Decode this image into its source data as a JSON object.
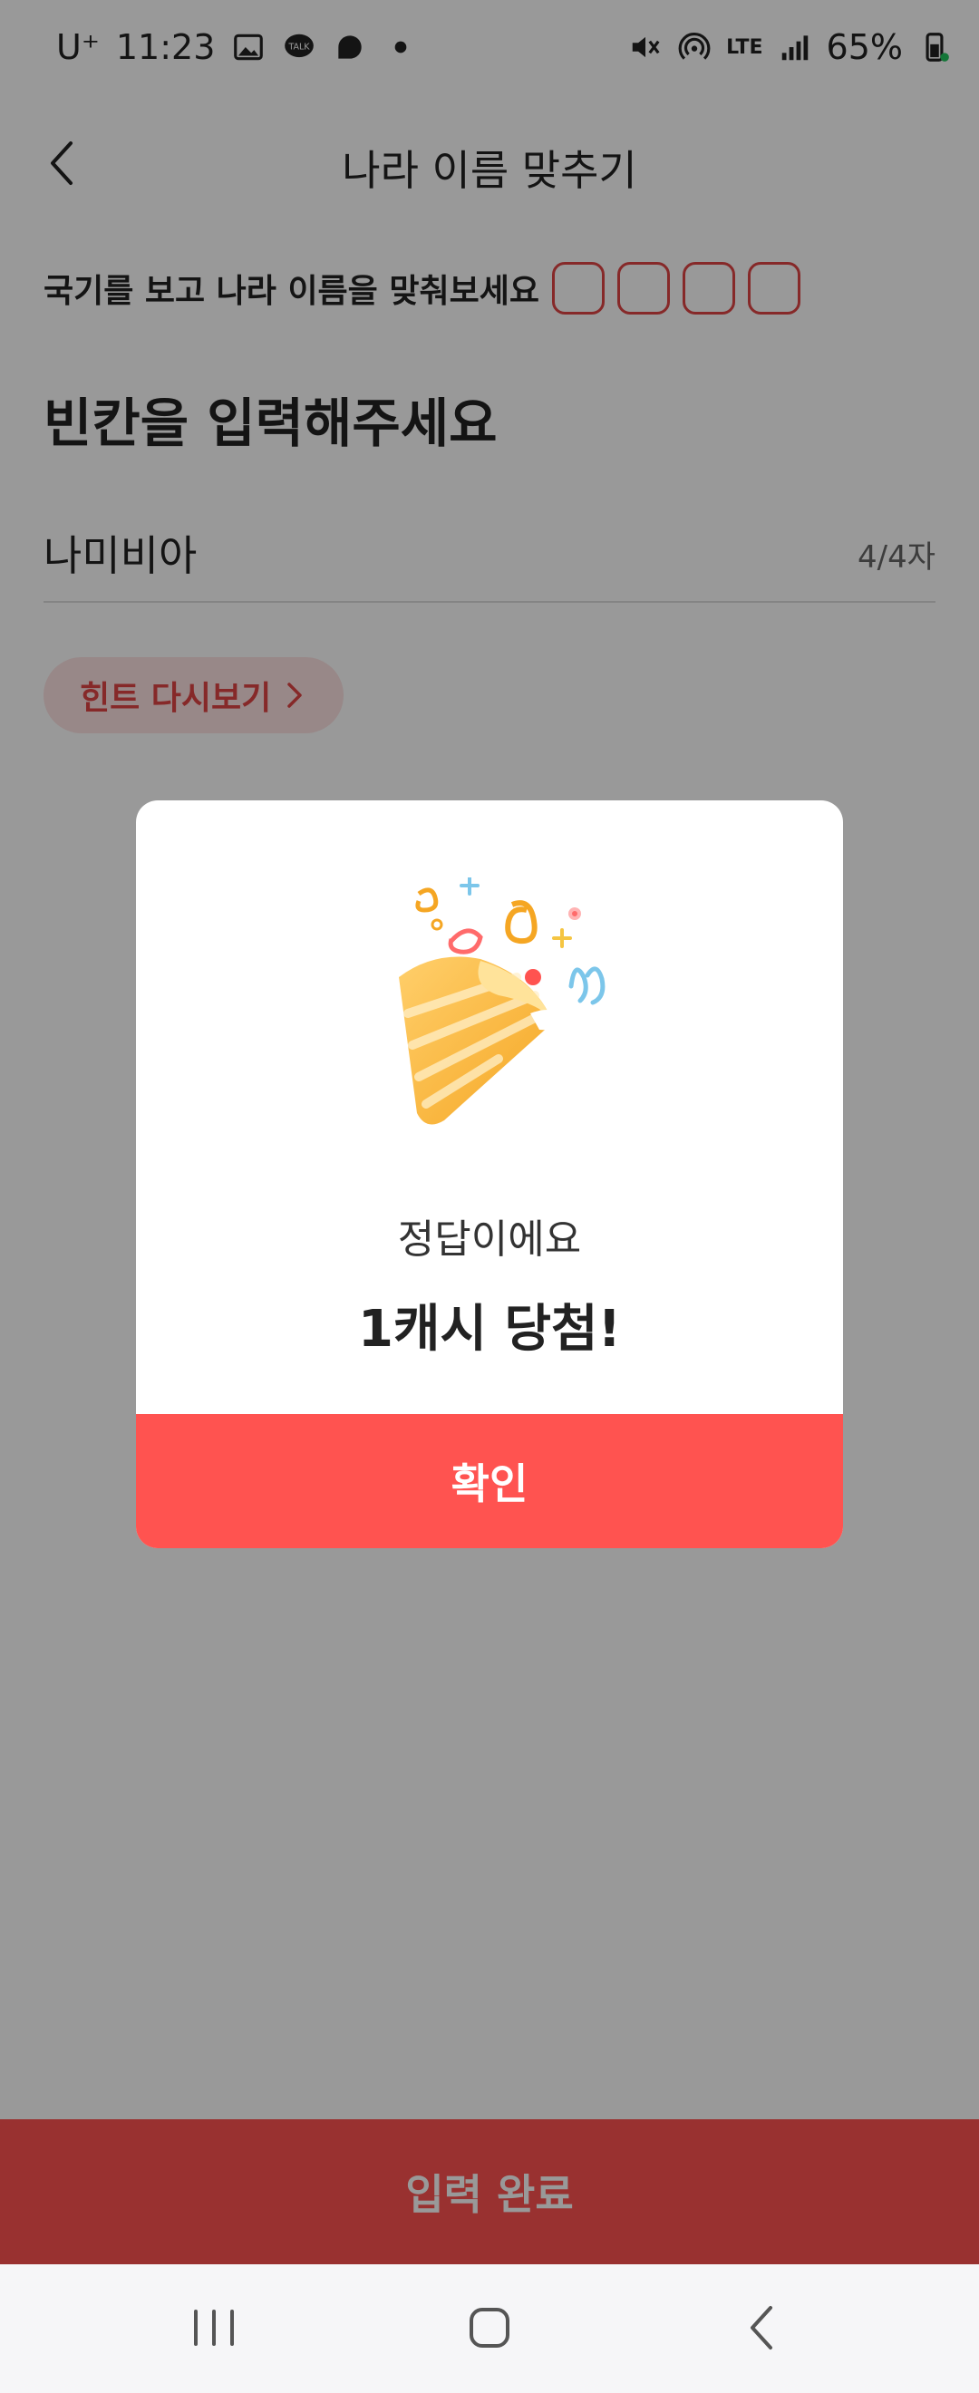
{
  "status_bar": {
    "carrier": "U⁺",
    "time": "11:23",
    "network": "LTE",
    "battery": "65%"
  },
  "header": {
    "title": "나라 이름 맞추기"
  },
  "question": {
    "instruction": "국기를 보고 나라 이름을 맞춰보세요",
    "blank_count": 4
  },
  "form": {
    "heading": "빈칸을 입력해주세요",
    "answer_value": "나미비아",
    "char_count": "4/4자"
  },
  "hint_button": {
    "label": "힌트 다시보기"
  },
  "submit_button": {
    "label": "입력 완료"
  },
  "dialog": {
    "message": "정답이에요",
    "reward": "1캐시 당첨!",
    "confirm_label": "확인",
    "illustration": "party-popper-icon"
  },
  "nav_bar": {
    "items": [
      "recents-icon",
      "home-icon",
      "back-icon"
    ]
  },
  "colors": {
    "accent": "#ff5350",
    "accent_light": "#fde3e3",
    "blank_border": "#e04545",
    "scrim": "rgba(0,0,0,0.40)"
  }
}
